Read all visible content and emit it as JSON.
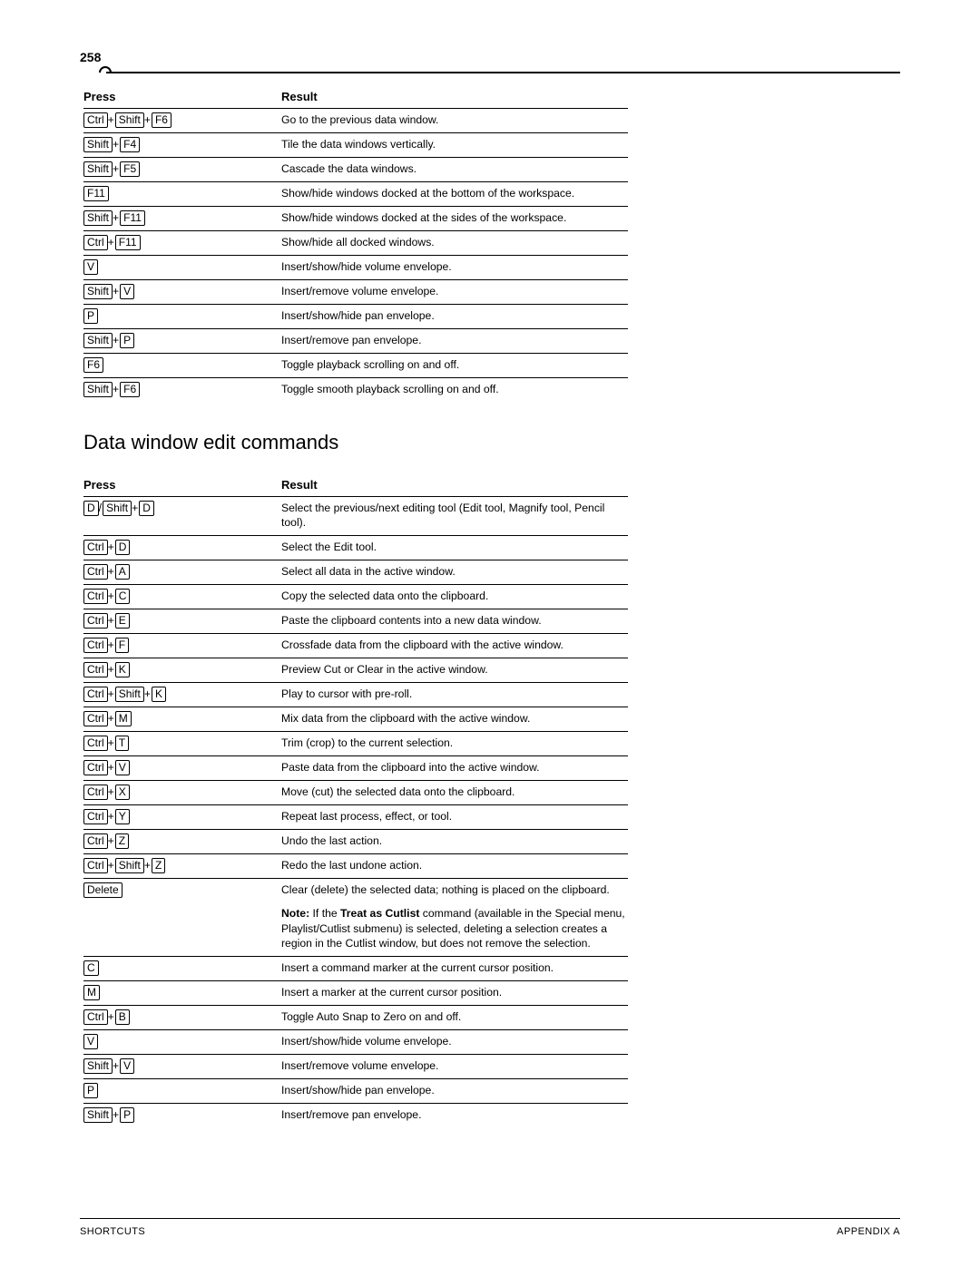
{
  "page_number": "258",
  "footer_left": "SHORTCUTS",
  "footer_right": "APPENDIX A",
  "table1_headers": {
    "press": "Press",
    "result": "Result"
  },
  "table1": [
    {
      "keys": [
        "Ctrl",
        "Shift",
        "F6"
      ],
      "sep": "+",
      "result": "Go to the previous data window."
    },
    {
      "keys": [
        "Shift",
        "F4"
      ],
      "sep": "+",
      "result": "Tile the data windows vertically."
    },
    {
      "keys": [
        "Shift",
        "F5"
      ],
      "sep": "+",
      "result": "Cascade the data windows."
    },
    {
      "keys": [
        "F11"
      ],
      "sep": "+",
      "result": "Show/hide windows docked at the bottom of the workspace."
    },
    {
      "keys": [
        "Shift",
        "F11"
      ],
      "sep": "+",
      "result": "Show/hide windows docked at the sides of the workspace."
    },
    {
      "keys": [
        "Ctrl",
        "F11"
      ],
      "sep": "+",
      "result": "Show/hide all docked windows."
    },
    {
      "keys": [
        "V"
      ],
      "sep": "+",
      "result": "Insert/show/hide volume envelope."
    },
    {
      "keys": [
        "Shift",
        "V"
      ],
      "sep": "+",
      "result": "Insert/remove volume envelope."
    },
    {
      "keys": [
        "P"
      ],
      "sep": "+",
      "result": "Insert/show/hide pan envelope."
    },
    {
      "keys": [
        "Shift",
        "P"
      ],
      "sep": "+",
      "result": "Insert/remove pan envelope."
    },
    {
      "keys": [
        "F6"
      ],
      "sep": "+",
      "result": "Toggle playback scrolling on and off."
    },
    {
      "keys": [
        "Shift",
        "F6"
      ],
      "sep": "+",
      "result": "Toggle smooth playback scrolling on and off."
    }
  ],
  "section2_title": "Data window edit commands",
  "table2_headers": {
    "press": "Press",
    "result": "Result"
  },
  "table2": [
    {
      "raw": "keycombo_d_shift_d",
      "result": "Select the previous/next editing tool (Edit tool, Magnify tool, Pencil tool)."
    },
    {
      "keys": [
        "Ctrl",
        "D"
      ],
      "sep": "+",
      "result": "Select the Edit tool."
    },
    {
      "keys": [
        "Ctrl",
        "A"
      ],
      "sep": "+",
      "result": "Select all data in the active window."
    },
    {
      "keys": [
        "Ctrl",
        "C"
      ],
      "sep": "+",
      "result": "Copy the selected data onto the clipboard."
    },
    {
      "keys": [
        "Ctrl",
        "E"
      ],
      "sep": "+",
      "result": "Paste the clipboard contents into a new data window."
    },
    {
      "keys": [
        "Ctrl",
        "F"
      ],
      "sep": "+",
      "result": "Crossfade data from the clipboard with the active window."
    },
    {
      "keys": [
        "Ctrl",
        "K"
      ],
      "sep": "+",
      "result": "Preview Cut or Clear in the active window."
    },
    {
      "keys": [
        "Ctrl",
        "Shift",
        "K"
      ],
      "sep": "+",
      "result": "Play to cursor with pre-roll."
    },
    {
      "keys": [
        "Ctrl",
        "M"
      ],
      "sep": "+",
      "result": "Mix data from the clipboard with the active window."
    },
    {
      "keys": [
        "Ctrl",
        "T"
      ],
      "sep": "+",
      "result": "Trim (crop) to the current selection."
    },
    {
      "keys": [
        "Ctrl",
        "V"
      ],
      "sep": "+",
      "result": "Paste data from the clipboard into the active window."
    },
    {
      "keys": [
        "Ctrl",
        "X"
      ],
      "sep": "+",
      "result": "Move (cut) the selected data onto the clipboard."
    },
    {
      "keys": [
        "Ctrl",
        "Y"
      ],
      "sep": "+",
      "result": "Repeat last process, effect, or tool."
    },
    {
      "keys": [
        "Ctrl",
        "Z"
      ],
      "sep": "+",
      "result": "Undo the last action."
    },
    {
      "keys": [
        "Ctrl",
        "Shift",
        "Z"
      ],
      "sep": "+",
      "result": "Redo the last undone action."
    },
    {
      "keys": [
        "Delete"
      ],
      "sep": "+",
      "result": "Clear (delete) the selected data; nothing is placed on the clipboard.",
      "note": {
        "bold1": "Note:",
        "text1": " If the ",
        "bold2": "Treat as Cutlist",
        "text2": " command (available in the Special menu, Playlist/Cutlist submenu) is selected, deleting a selection creates a region in the Cutlist window, but does not remove the selection."
      }
    },
    {
      "keys": [
        "C"
      ],
      "sep": "+",
      "result": "Insert a command marker at the current cursor position."
    },
    {
      "keys": [
        "M"
      ],
      "sep": "+",
      "result": "Insert a marker at the current cursor position."
    },
    {
      "keys": [
        "Ctrl",
        "B"
      ],
      "sep": "+",
      "result": "Toggle Auto Snap to Zero on and off."
    },
    {
      "keys": [
        "V"
      ],
      "sep": "+",
      "result": "Insert/show/hide volume envelope."
    },
    {
      "keys": [
        "Shift",
        "V"
      ],
      "sep": "+",
      "result": "Insert/remove volume envelope."
    },
    {
      "keys": [
        "P"
      ],
      "sep": "+",
      "result": "Insert/show/hide pan envelope."
    },
    {
      "keys": [
        "Shift",
        "P"
      ],
      "sep": "+",
      "result": "Insert/remove pan envelope."
    }
  ],
  "special_key_parts": {
    "d": "D",
    "shift": "Shift"
  }
}
